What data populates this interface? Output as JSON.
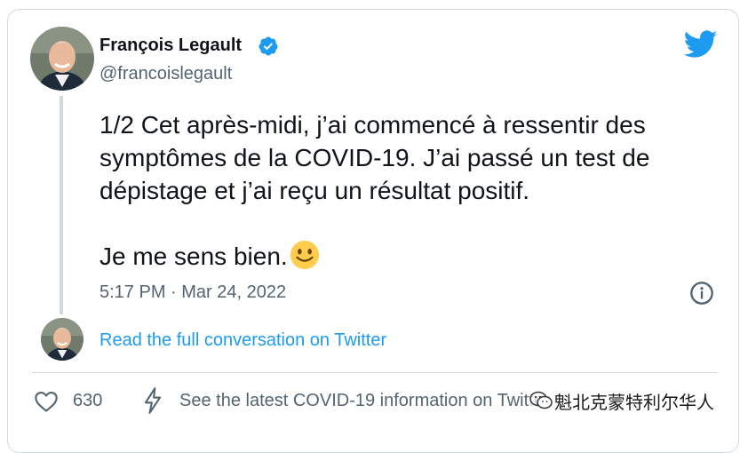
{
  "author": {
    "name": "François Legault",
    "handle": "@francoislegault",
    "verified": true
  },
  "tweet": {
    "paragraph1": "1/2 Cet après-midi, j’ai commencé à ressentir des symptômes de la COVID-19. J’ai passé un test de dépistage et j’ai reçu un résultat positif.",
    "paragraph2": "Je me sens bien.",
    "emoji": "slightly-smiling-face",
    "timestamp": "5:17 PM · Mar 24, 2022"
  },
  "conversation_link": "Read the full conversation on Twitter",
  "actions": {
    "like_count": "630",
    "covid_info": "See the latest COVID-19 information on Twitter"
  },
  "watermark": {
    "text": "魁北克蒙特利尔华人"
  },
  "icons": {
    "logo": "twitter-bird-icon",
    "verified": "verified-badge-icon",
    "info": "info-icon",
    "like": "heart-icon",
    "bolt": "lightning-bolt-icon"
  },
  "colors": {
    "twitter_blue": "#1d9bf0",
    "text_primary": "#0f1419",
    "text_secondary": "#536471",
    "border": "#cfd9de"
  }
}
